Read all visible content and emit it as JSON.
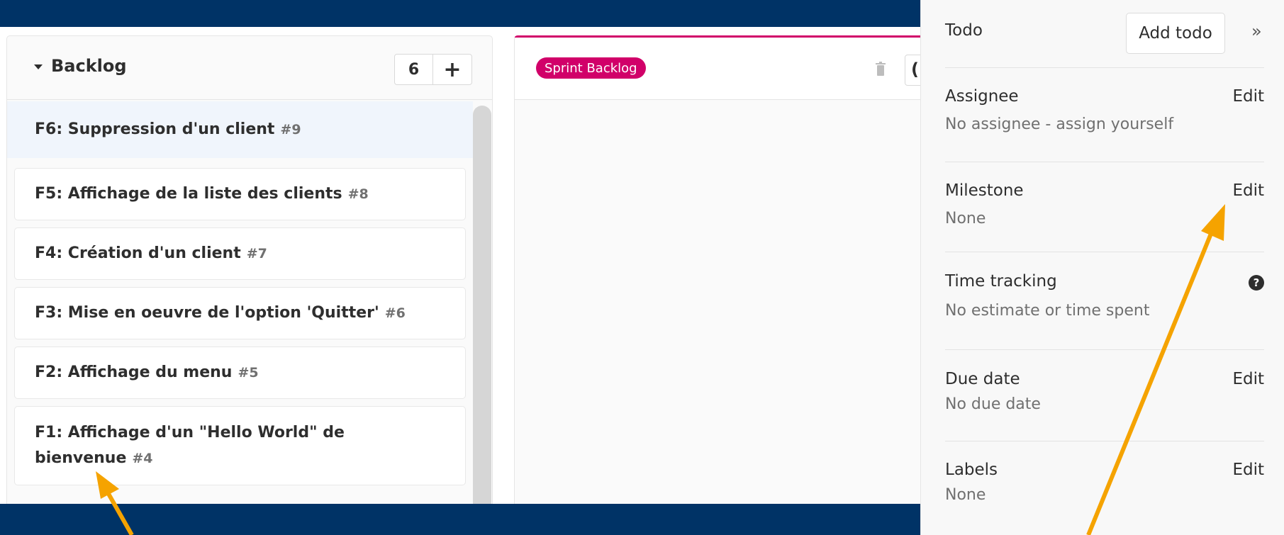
{
  "board": {
    "backlog": {
      "title": "Backlog",
      "count": "6",
      "add_label": "+",
      "cards": [
        {
          "title": "F6: Suppression d'un client",
          "ref": "#9"
        },
        {
          "title": "F5: Affichage de la liste des clients",
          "ref": "#8"
        },
        {
          "title": "F4: Création d'un client",
          "ref": "#7"
        },
        {
          "title": "F3: Mise en oeuvre de l'option 'Quitter'",
          "ref": "#6"
        },
        {
          "title": "F2: Affichage du menu",
          "ref": "#5"
        },
        {
          "title": "F1: Affichage d'un \"Hello World\" de bienvenue",
          "title_line1": "F1: Affichage d'un \"Hello World\" de",
          "title_line2": "bienvenue",
          "ref": "#4"
        }
      ]
    },
    "sprint": {
      "label": "Sprint Backlog",
      "label_color": "#d10069",
      "menu_glyph": "("
    }
  },
  "sidebar": {
    "todo_label": "Todo",
    "add_todo": "Add todo",
    "collapse_glyph": "»",
    "sections": {
      "assignee": {
        "title": "Assignee",
        "edit": "Edit",
        "value": "No assignee - assign yourself"
      },
      "milestone": {
        "title": "Milestone",
        "edit": "Edit",
        "value": "None"
      },
      "time_tracking": {
        "title": "Time tracking",
        "help": "?",
        "value": "No estimate or time spent"
      },
      "due_date": {
        "title": "Due date",
        "edit": "Edit",
        "value": "No due date"
      },
      "labels": {
        "title": "Labels",
        "edit": "Edit",
        "value": "None"
      }
    }
  },
  "colors": {
    "background": "#003366",
    "annotation_arrow": "#f5a300"
  }
}
